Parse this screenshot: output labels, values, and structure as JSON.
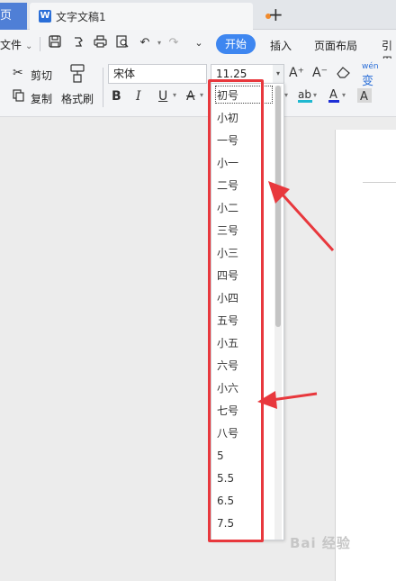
{
  "titlebar": {
    "home_label": "页",
    "doc_title": "文字文稿1",
    "doc_icon_letter": "W",
    "new_tab": "+"
  },
  "menubar": {
    "file_label": "文件",
    "tabs": [
      "开始",
      "插入",
      "页面布局",
      "引用"
    ]
  },
  "ribbon": {
    "cut": "剪切",
    "copy": "复制",
    "format_painter": "格式刷",
    "font_name": "宋体",
    "font_size": "11.25",
    "bold": "B",
    "italic": "I",
    "underline": "U",
    "grow_font": "A⁺",
    "shrink_font": "A⁻",
    "pinyin_label": "wén"
  },
  "font_size_options": [
    "初号",
    "小初",
    "一号",
    "小一",
    "二号",
    "小二",
    "三号",
    "小三",
    "四号",
    "小四",
    "五号",
    "小五",
    "六号",
    "小六",
    "七号",
    "八号",
    "5",
    "5.5",
    "6.5",
    "7.5"
  ],
  "watermark": "Bai 经验",
  "colors": {
    "accent": "#3e86f0",
    "highlight": "#e8383d",
    "arrow": "#e8383d"
  }
}
